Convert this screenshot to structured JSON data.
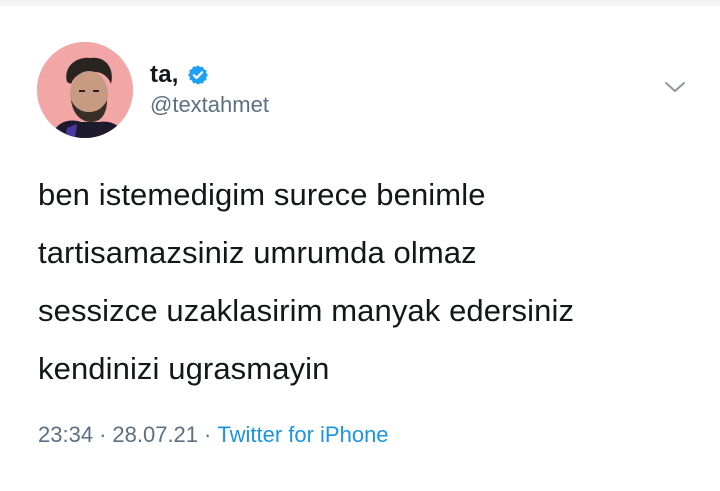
{
  "author": {
    "display_name": "ta,",
    "handle": "@textahmet",
    "verified_icon": "verified-badge-icon",
    "avatar_icon": "profile-avatar"
  },
  "tweet": {
    "text": "ben istemedigim surece benimle\ntartisamazsiniz umrumda olmaz\nsessizce uzaklasirim manyak edersiniz\nkendinizi ugrasmayin"
  },
  "meta": {
    "time": "23:34",
    "separator": "·",
    "date": "28.07.21",
    "source": "Twitter for iPhone"
  },
  "menu": {
    "icon": "chevron-down-icon"
  },
  "colors": {
    "verified": "#1da1f2",
    "link": "#1b95e0",
    "muted": "#5b7083",
    "avatar_bg": "#f2a6a6"
  }
}
